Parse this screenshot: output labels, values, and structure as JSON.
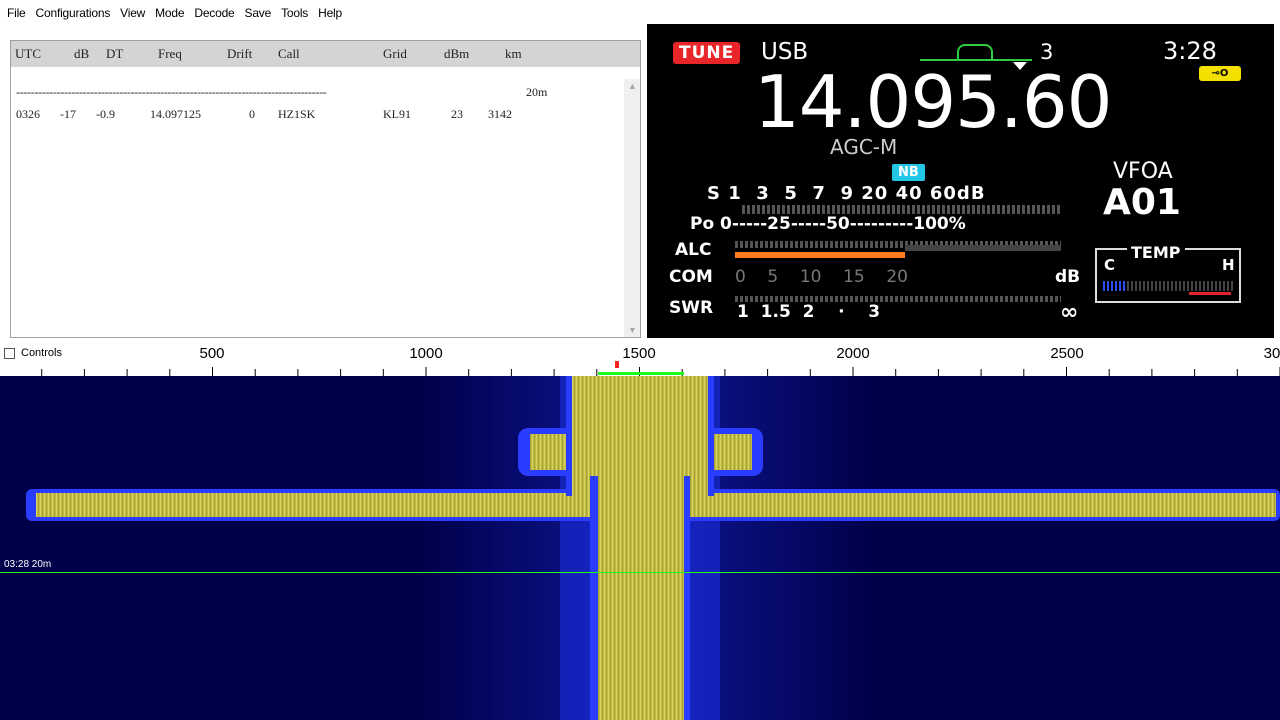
{
  "menu": {
    "items": [
      "File",
      "Configurations",
      "View",
      "Mode",
      "Decode",
      "Save",
      "Tools",
      "Help"
    ]
  },
  "decode": {
    "headers": [
      "UTC",
      "dB",
      "DT",
      "Freq",
      "Drift",
      "Call",
      "Grid",
      "dBm",
      "km"
    ],
    "separator": "------------------------------------------------------------------------------------",
    "band": "20m",
    "rows": [
      {
        "utc": "0326",
        "db": "-17",
        "dt": "-0.9",
        "freq": "14.097125",
        "drift": "0",
        "call": "HZ1SK",
        "grid": "KL91",
        "dbm": "23",
        "km": "3142"
      }
    ]
  },
  "radio": {
    "tune": "TUNE",
    "mode": "USB",
    "filter": "3",
    "time": "3:28",
    "frequency": "14.095.60",
    "agc": "AGC-M",
    "nb": "NB",
    "vfo": "VFOA",
    "memory": "A01",
    "s_scale": "S 1  3  5  7  9 20 40 60dB",
    "po_scale": "Po 0-----25-----50---------100%",
    "alc": "ALC",
    "com": "COM",
    "com_scale": "0    5    10    15    20",
    "db": "dB",
    "swr": "SWR",
    "swr_scale": "1  1.5  2    ·    3",
    "infinity": "∞",
    "temp": "TEMP",
    "temp_c": "C",
    "temp_h": "H",
    "alc_level": 0.52
  },
  "waterfall": {
    "controls_label": "Controls",
    "scale_labels": [
      "500",
      "1000",
      "1500",
      "2000",
      "2500",
      "30"
    ],
    "timestamp": "03:28   20m",
    "colors": {
      "background": "#00004a",
      "signal": "#c8c043",
      "edge": "#2a3cff",
      "line": "#1aff1a"
    }
  }
}
